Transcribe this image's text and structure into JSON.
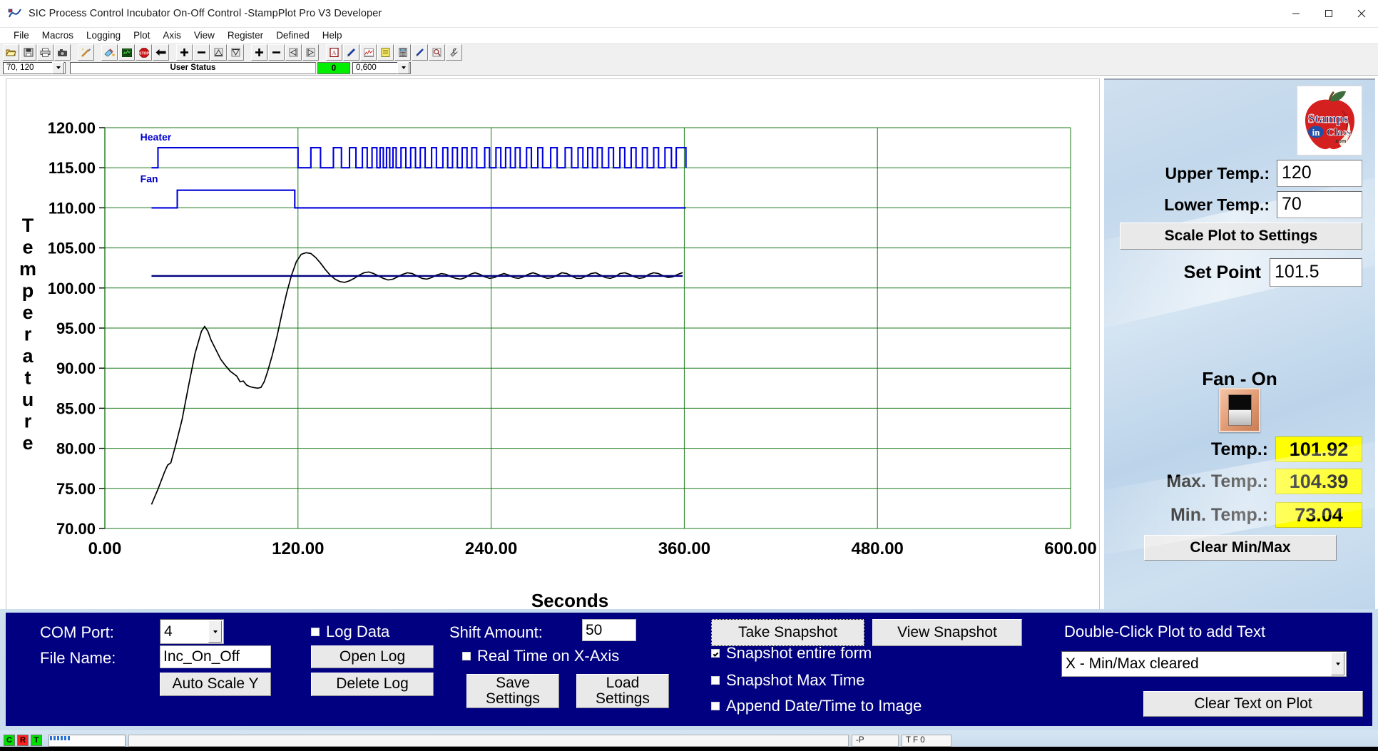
{
  "window": {
    "title": "SIC Process Control Incubator On-Off Control -StampPlot Pro V3 Developer",
    "app_icon": "stampplot-icon",
    "minimize": "minimize-icon",
    "maximize": "maximize-icon",
    "close": "close-icon"
  },
  "menu": [
    "File",
    "Macros",
    "Logging",
    "Plot",
    "Axis",
    "View",
    "Register",
    "Defined",
    "Help"
  ],
  "toolbar": {
    "buttons": [
      "open-folder-icon",
      "save-disk-icon",
      "print-icon",
      "camera-icon",
      "wand-icon",
      "paint-icon",
      "monitor-icon",
      "stop-icon",
      "arrow-left-icon",
      "plus-icon",
      "minus-icon",
      "scale-up-icon",
      "scale-down-icon",
      "plus2-icon",
      "minus2-icon",
      "pan-left-icon",
      "pan-right-icon",
      "pdf-icon",
      "pen-icon",
      "chart-icon",
      "notes-icon",
      "calculator-icon",
      "pointer-icon",
      "magnify-icon",
      "wrench-icon"
    ]
  },
  "status_row": {
    "range_combo": "70, 120",
    "user_status": "User Status",
    "counter": "0",
    "time_combo": "0,600"
  },
  "chart_data": {
    "type": "line",
    "title": "",
    "xlabel": "Seconds",
    "ylabel": "Temperature",
    "xlim": [
      0,
      600
    ],
    "ylim": [
      70,
      120
    ],
    "xticks": [
      "0.00",
      "120.00",
      "240.00",
      "360.00",
      "480.00",
      "600.00"
    ],
    "xtick_values": [
      0,
      120,
      240,
      360,
      480,
      600
    ],
    "yticks": [
      "70.00",
      "75.00",
      "80.00",
      "85.00",
      "90.00",
      "95.00",
      "100.00",
      "105.00",
      "110.00",
      "115.00",
      "120.00"
    ],
    "ytick_values": [
      70,
      75,
      80,
      85,
      90,
      95,
      100,
      105,
      110,
      115,
      120
    ],
    "grid": true,
    "grid_color": "#1a7a1a",
    "annotations": [
      {
        "text": "Heater",
        "x": 22,
        "y": 118.4,
        "color": "#0000cc"
      },
      {
        "text": "Fan",
        "x": 22,
        "y": 113.2,
        "color": "#0000cc"
      }
    ],
    "series": [
      {
        "name": "Temperature",
        "color": "#000000",
        "type": "line",
        "points": [
          [
            29,
            73.0
          ],
          [
            33,
            74.9
          ],
          [
            37,
            77.0
          ],
          [
            39,
            77.9
          ],
          [
            41,
            78.2
          ],
          [
            44,
            80.4
          ],
          [
            48,
            83.6
          ],
          [
            52,
            87.8
          ],
          [
            56,
            91.8
          ],
          [
            60,
            94.6
          ],
          [
            62,
            95.2
          ],
          [
            64,
            94.6
          ],
          [
            66,
            93.5
          ],
          [
            69,
            92.3
          ],
          [
            72,
            91.1
          ],
          [
            75,
            90.3
          ],
          [
            78,
            89.6
          ],
          [
            80,
            89.3
          ],
          [
            82,
            89.0
          ],
          [
            84,
            88.3
          ],
          [
            86,
            88.4
          ],
          [
            88,
            87.9
          ],
          [
            90,
            87.7
          ],
          [
            92,
            87.6
          ],
          [
            95,
            87.5
          ],
          [
            97,
            87.6
          ],
          [
            99,
            88.3
          ],
          [
            101,
            89.5
          ],
          [
            104,
            91.6
          ],
          [
            107,
            94.0
          ],
          [
            110,
            96.8
          ],
          [
            113,
            99.4
          ],
          [
            116,
            101.6
          ],
          [
            119,
            103.3
          ],
          [
            122,
            104.2
          ],
          [
            125,
            104.4
          ],
          [
            128,
            104.3
          ],
          [
            131,
            103.8
          ],
          [
            134,
            103.1
          ],
          [
            137,
            102.3
          ],
          [
            140,
            101.6
          ],
          [
            143,
            101.1
          ],
          [
            146,
            100.8
          ],
          [
            149,
            100.7
          ],
          [
            152,
            100.9
          ],
          [
            155,
            101.2
          ],
          [
            158,
            101.6
          ],
          [
            161,
            101.9
          ],
          [
            164,
            102.0
          ],
          [
            167,
            101.8
          ],
          [
            170,
            101.5
          ],
          [
            173,
            101.2
          ],
          [
            176,
            101.0
          ],
          [
            179,
            101.1
          ],
          [
            182,
            101.4
          ],
          [
            185,
            101.7
          ],
          [
            188,
            101.9
          ],
          [
            191,
            101.8
          ],
          [
            194,
            101.5
          ],
          [
            197,
            101.2
          ],
          [
            200,
            101.1
          ],
          [
            203,
            101.3
          ],
          [
            206,
            101.6
          ],
          [
            209,
            101.8
          ],
          [
            212,
            101.7
          ],
          [
            215,
            101.4
          ],
          [
            218,
            101.2
          ],
          [
            221,
            101.1
          ],
          [
            224,
            101.3
          ],
          [
            227,
            101.7
          ],
          [
            230,
            101.9
          ],
          [
            233,
            101.7
          ],
          [
            236,
            101.4
          ],
          [
            239,
            101.2
          ],
          [
            242,
            101.3
          ],
          [
            245,
            101.6
          ],
          [
            248,
            101.8
          ],
          [
            251,
            101.6
          ],
          [
            254,
            101.3
          ],
          [
            257,
            101.2
          ],
          [
            260,
            101.4
          ],
          [
            263,
            101.7
          ],
          [
            266,
            101.9
          ],
          [
            269,
            101.7
          ],
          [
            272,
            101.4
          ],
          [
            275,
            101.2
          ],
          [
            278,
            101.3
          ],
          [
            281,
            101.6
          ],
          [
            284,
            101.9
          ],
          [
            287,
            101.8
          ],
          [
            290,
            101.5
          ],
          [
            293,
            101.2
          ],
          [
            296,
            101.2
          ],
          [
            299,
            101.5
          ],
          [
            302,
            101.8
          ],
          [
            305,
            101.9
          ],
          [
            308,
            101.6
          ],
          [
            311,
            101.3
          ],
          [
            314,
            101.2
          ],
          [
            317,
            101.4
          ],
          [
            320,
            101.8
          ],
          [
            323,
            101.9
          ],
          [
            326,
            101.7
          ],
          [
            329,
            101.4
          ],
          [
            332,
            101.2
          ],
          [
            335,
            101.3
          ],
          [
            338,
            101.7
          ],
          [
            341,
            101.9
          ],
          [
            344,
            101.8
          ],
          [
            347,
            101.5
          ],
          [
            350,
            101.3
          ],
          [
            353,
            101.4
          ],
          [
            356,
            101.7
          ],
          [
            359,
            101.92
          ]
        ]
      },
      {
        "name": "Set Point",
        "color": "#000080",
        "type": "hline",
        "value": 101.5,
        "x_start": 29,
        "x_end": 359
      },
      {
        "name": "Heater",
        "color": "#0000dd",
        "type": "digital",
        "low": 115,
        "high": 117.5,
        "x_start": 29,
        "x_end": 361,
        "transitions": [
          [
            29,
            0
          ],
          [
            33,
            1
          ],
          [
            120,
            0
          ],
          [
            128,
            1
          ],
          [
            134,
            0
          ],
          [
            142,
            1
          ],
          [
            147,
            0
          ],
          [
            152,
            1
          ],
          [
            156,
            0
          ],
          [
            160,
            1
          ],
          [
            163,
            0
          ],
          [
            166,
            1
          ],
          [
            169,
            0
          ],
          [
            171,
            1
          ],
          [
            173,
            0
          ],
          [
            175,
            1
          ],
          [
            177,
            0
          ],
          [
            179,
            1
          ],
          [
            181,
            0
          ],
          [
            184,
            1
          ],
          [
            187,
            0
          ],
          [
            190,
            1
          ],
          [
            193,
            0
          ],
          [
            196,
            1
          ],
          [
            199,
            0
          ],
          [
            203,
            1
          ],
          [
            206,
            0
          ],
          [
            210,
            1
          ],
          [
            213,
            0
          ],
          [
            216,
            1
          ],
          [
            219,
            0
          ],
          [
            222,
            1
          ],
          [
            225,
            0
          ],
          [
            228,
            1
          ],
          [
            231,
            0
          ],
          [
            236,
            1
          ],
          [
            239,
            0
          ],
          [
            243,
            1
          ],
          [
            246,
            0
          ],
          [
            249,
            1
          ],
          [
            252,
            0
          ],
          [
            255,
            1
          ],
          [
            258,
            0
          ],
          [
            262,
            1
          ],
          [
            265,
            0
          ],
          [
            269,
            1
          ],
          [
            272,
            0
          ],
          [
            277,
            1
          ],
          [
            281,
            0
          ],
          [
            286,
            1
          ],
          [
            290,
            0
          ],
          [
            294,
            1
          ],
          [
            297,
            0
          ],
          [
            300,
            1
          ],
          [
            303,
            0
          ],
          [
            306,
            1
          ],
          [
            309,
            0
          ],
          [
            313,
            1
          ],
          [
            316,
            0
          ],
          [
            320,
            1
          ],
          [
            323,
            0
          ],
          [
            327,
            1
          ],
          [
            330,
            0
          ],
          [
            334,
            1
          ],
          [
            337,
            0
          ],
          [
            341,
            1
          ],
          [
            344,
            0
          ],
          [
            348,
            1
          ],
          [
            352,
            0
          ],
          [
            355,
            1
          ],
          [
            361,
            0
          ]
        ]
      },
      {
        "name": "Fan",
        "color": "#0000dd",
        "type": "digital",
        "low": 110,
        "high": 112.2,
        "x_start": 29,
        "x_end": 361,
        "transitions": [
          [
            29,
            0
          ],
          [
            45,
            1
          ],
          [
            118,
            0
          ],
          [
            361,
            0
          ]
        ]
      }
    ]
  },
  "right_panel": {
    "logo": "stamps-in-class-apple-logo",
    "upper_temp_label": "Upper Temp.:",
    "upper_temp_value": "120",
    "lower_temp_label": "Lower Temp.:",
    "lower_temp_value": "70",
    "scale_plot_button": "Scale Plot to Settings",
    "set_point_label": "Set Point",
    "set_point_value": "101.5",
    "fan_status": "Fan - On",
    "fan_switch_icon": "rocker-switch-icon",
    "temp_label": "Temp.:",
    "temp_value": "101.92",
    "max_temp_label": "Max. Temp.:",
    "max_temp_value": "104.39",
    "min_temp_label": "Min. Temp.:",
    "min_temp_value": "73.04",
    "clear_minmax_button": "Clear Min/Max"
  },
  "bottom_panel": {
    "com_port_label": "COM Port:",
    "com_port_value": "4",
    "file_name_label": "File Name:",
    "file_name_value": "Inc_On_Off",
    "auto_scale_button": "Auto Scale Y",
    "log_data_label": "Log Data",
    "log_data_checked": false,
    "open_log_button": "Open Log",
    "delete_log_button": "Delete Log",
    "shift_amount_label": "Shift Amount:",
    "shift_amount_value": "50",
    "real_time_label": "Real Time on X-Axis",
    "real_time_checked": false,
    "save_settings_button": "Save\nSettings",
    "save_settings_line1": "Save",
    "save_settings_line2": "Settings",
    "load_settings_line1": "Load",
    "load_settings_line2": "Settings",
    "take_snapshot_button": "Take Snapshot",
    "view_snapshot_button": "View Snapshot",
    "snapshot_entire_form_label": "Snapshot entire form",
    "snapshot_entire_form_checked": true,
    "snapshot_max_time_label": "Snapshot Max Time",
    "snapshot_max_time_checked": false,
    "append_datetime_label": "Append Date/Time to Image",
    "append_datetime_checked": false,
    "double_click_label": "Double-Click Plot to add Text",
    "text_combo_value": "X - Min/Max cleared",
    "clear_text_button": "Clear Text on Plot"
  },
  "status_bar": {
    "led_c": "C",
    "led_r": "R",
    "led_t": "T",
    "field_p": "-P",
    "field_t": "T F 0"
  }
}
